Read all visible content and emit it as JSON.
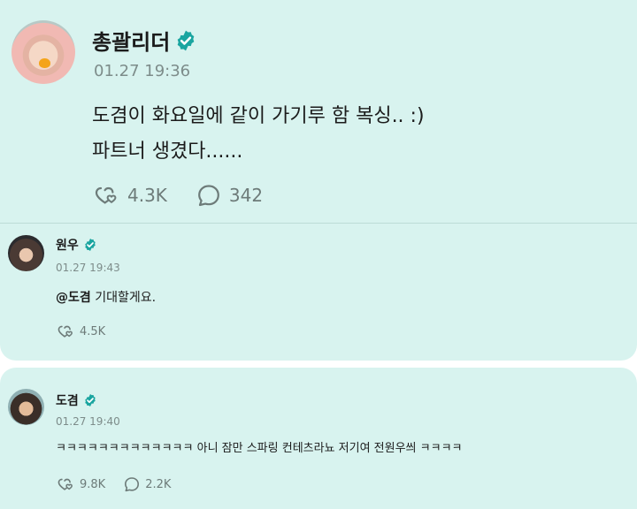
{
  "post": {
    "author": "총괄리더",
    "timestamp": "01.27 19:36",
    "lines": [
      "도겸이 화요일에 같이 가기루 함 복싱.. :)",
      "파트너 생겼다......"
    ],
    "likes": "4.3K",
    "comments": "342"
  },
  "replies": [
    {
      "author": "원우",
      "timestamp": "01.27 19:43",
      "mention": "@도겸",
      "text": " 기대할게요.",
      "likes": "4.5K"
    },
    {
      "author": "도겸",
      "timestamp": "01.27 19:40",
      "text": "ㅋㅋㅋㅋㅋㅋㅋㅋㅋㅋㅋㅋㅋ 아니 잠만 스파링 컨테츠라뇨 저기여 전원우씌 ㅋㅋㅋㅋ",
      "likes": "9.8K",
      "comments": "2.2K"
    }
  ],
  "colors": {
    "background": "#d8f3ef",
    "verified": "#1aa5a0",
    "muted": "#6d7b79"
  },
  "icons": {
    "verified": "verified-badge-icon",
    "like": "heart-reaction-icon",
    "comment": "speech-bubble-icon"
  }
}
